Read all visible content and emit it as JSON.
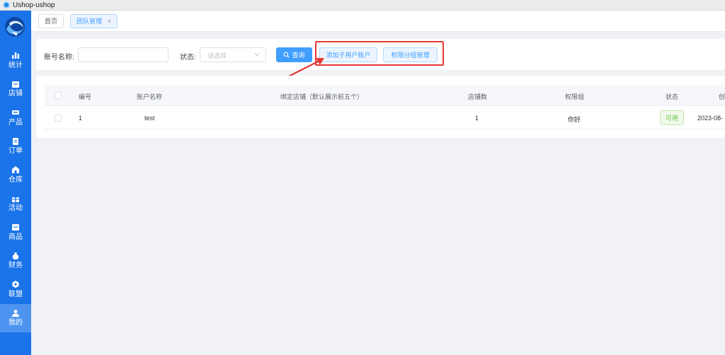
{
  "window": {
    "title": "Ushop-ushop"
  },
  "sidebar": {
    "items": [
      {
        "label": "统计",
        "icon": "bar-chart-icon"
      },
      {
        "label": "店铺",
        "icon": "store-icon"
      },
      {
        "label": "产品",
        "icon": "product-icon"
      },
      {
        "label": "订单",
        "icon": "order-icon"
      },
      {
        "label": "仓库",
        "icon": "warehouse-icon"
      },
      {
        "label": "活动",
        "icon": "gift-icon"
      },
      {
        "label": "商品",
        "icon": "goods-icon"
      },
      {
        "label": "财务",
        "icon": "money-bag-icon"
      },
      {
        "label": "联盟",
        "icon": "alliance-icon"
      },
      {
        "label": "我的",
        "icon": "user-icon"
      }
    ],
    "active_index": 9
  },
  "tabs": [
    {
      "label": "首页"
    },
    {
      "label": "团队管理",
      "close": "×"
    }
  ],
  "filter": {
    "account_label": "账号名称:",
    "account_value": "",
    "status_label": "状态:",
    "status_placeholder": "请选择",
    "search_label": "查询",
    "add_sub_account_label": "添加子用户账户",
    "permission_group_label": "权限分组管理"
  },
  "table": {
    "headers": [
      "编号",
      "账户名称",
      "绑定店铺（默认展示前五个）",
      "店铺数",
      "权限组",
      "状态",
      "创"
    ],
    "rows": [
      {
        "id": "1",
        "name": "test",
        "shops": "",
        "shop_count": "1",
        "group": "你好",
        "status": "可用",
        "created": "2023-08-"
      }
    ]
  },
  "colors": {
    "sidebar": "#1a73e8",
    "primary": "#409eff",
    "highlight": "#e53935",
    "success": "#67c23a"
  }
}
